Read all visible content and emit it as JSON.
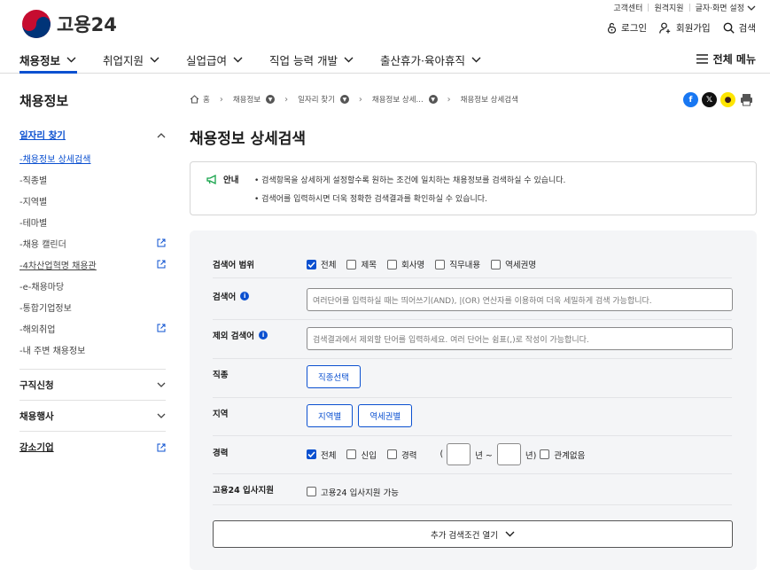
{
  "header": {
    "logo_text": "고용24",
    "util_links": [
      "고객센터",
      "원격지원",
      "글자·화면 설정"
    ],
    "login": "로그인",
    "signup": "회원가입",
    "search": "검색",
    "all_menu": "전체 메뉴"
  },
  "gnb": [
    "채용정보",
    "취업지원",
    "실업급여",
    "직업 능력 개발",
    "출산휴가·육아휴직"
  ],
  "lnb": {
    "title": "채용정보",
    "group": "일자리 찾기",
    "items": [
      "채용정보 상세검색",
      "직종별",
      "지역별",
      "테마별",
      "채용 캘린더",
      "4차산업혁명 채용관",
      "e-채용마당",
      "통합기업정보",
      "해외취업",
      "내 주변 채용정보"
    ],
    "sections": [
      "구직신청",
      "채용행사",
      "강소기업"
    ]
  },
  "breadcrumb": [
    "홈",
    "채용정보",
    "일자리 찾기",
    "채용정보 상세...",
    "채용정보 상세검색"
  ],
  "page_title": "채용정보 상세검색",
  "notice": {
    "label": "안내",
    "lines": [
      "• 검색항목을 상세하게 설정할수록 원하는 조건에 일치하는 채용정보를 검색하실 수 있습니다.",
      "• 검색어를 입력하시면 더욱 정확한 검색결과를 확인하실 수 있습니다."
    ]
  },
  "form": {
    "scope_label": "검색어 범위",
    "scope_options": [
      {
        "label": "전체",
        "checked": true
      },
      {
        "label": "제목",
        "checked": false
      },
      {
        "label": "회사명",
        "checked": false
      },
      {
        "label": "직무내용",
        "checked": false
      },
      {
        "label": "역세권명",
        "checked": false
      }
    ],
    "keyword_label": "검색어",
    "keyword_placeholder": "여러단어를 입력하실 때는 띄어쓰기(AND), |(OR) 연산자를 이용하여 더욱 세밀하게 검색 가능합니다.",
    "exclude_label": "제외 검색어",
    "exclude_placeholder": "검색결과에서 제외할 단어를 입력하세요. 여러 단어는 쉼표(,)로 작성이 가능합니다.",
    "job_label": "직종",
    "job_button": "직종선택",
    "region_label": "지역",
    "region_buttons": [
      "지역별",
      "역세권별"
    ],
    "career_label": "경력",
    "career_options": [
      {
        "label": "전체",
        "checked": true
      },
      {
        "label": "신입",
        "checked": false
      },
      {
        "label": "경력",
        "checked": false
      }
    ],
    "career_open": "(",
    "career_mid": "년 ~",
    "career_close": "년)",
    "career_any": "관계없음",
    "support_label": "고용24 입사지원",
    "support_option": "고용24 입사지원 가능",
    "more_button": "추가 검색조건 열기"
  },
  "colors": {
    "accent": "#0b50d0",
    "panel_bg": "#f4f5f7"
  }
}
